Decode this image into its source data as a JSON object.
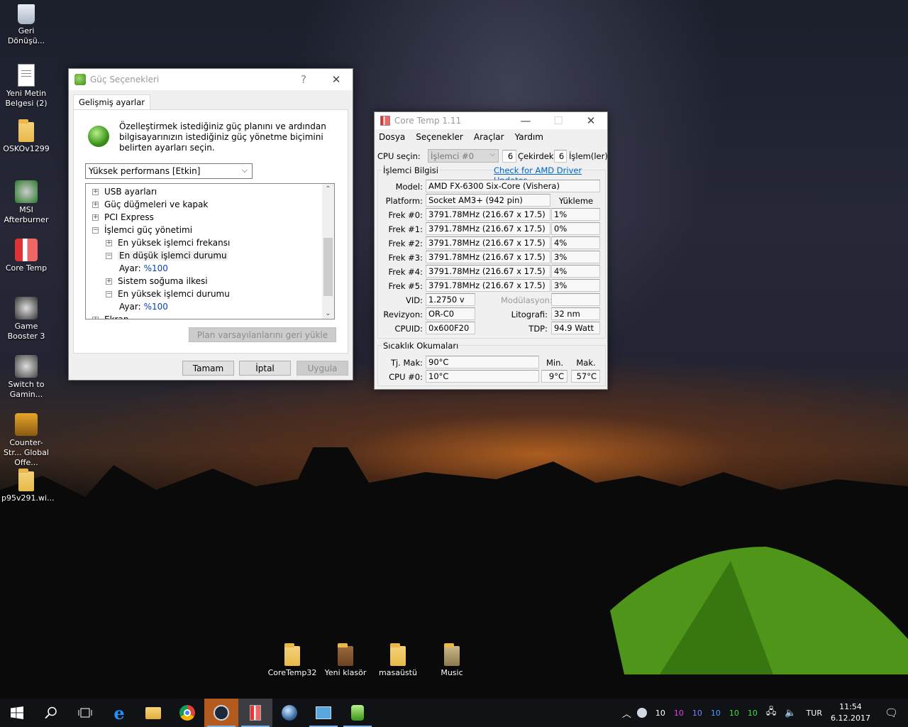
{
  "desktop": {
    "icons": [
      {
        "label": "Geri Dönüşü...",
        "icon": "recycle-bin-icon"
      },
      {
        "label": "Yeni Metin Belgesi (2)",
        "icon": "text-file-icon"
      },
      {
        "label": "OSKOv1299",
        "icon": "folder-icon"
      },
      {
        "label": "MSI Afterburner",
        "icon": "msi-afterburner-icon"
      },
      {
        "label": "Core Temp",
        "icon": "core-temp-icon"
      },
      {
        "label": "Game Booster 3",
        "icon": "game-booster-icon"
      },
      {
        "label": "Switch to Gamin...",
        "icon": "switch-gaming-icon"
      },
      {
        "label": "Counter-Str... Global Offe...",
        "icon": "csgo-icon"
      },
      {
        "label": "p95v291.wi...",
        "icon": "folder-icon"
      }
    ],
    "bottom_icons": [
      {
        "label": "CoreTemp32"
      },
      {
        "label": "Yeni klasör"
      },
      {
        "label": "masaüstü"
      },
      {
        "label": "Music"
      }
    ]
  },
  "power_dialog": {
    "title": "Güç Seçenekleri",
    "help": "?",
    "close": "✕",
    "tab": "Gelişmiş ayarlar",
    "description": "Özelleştirmek istediğiniz güç planını ve ardından bilgisayarınızın istediğiniz güç yönetme biçimini belirten ayarları seçin.",
    "plan_select": "Yüksek performans [Etkin]",
    "tree": [
      {
        "indent": 0,
        "sign": "+",
        "label": "USB ayarları"
      },
      {
        "indent": 0,
        "sign": "+",
        "label": "Güç düğmeleri ve kapak"
      },
      {
        "indent": 0,
        "sign": "+",
        "label": "PCI Express"
      },
      {
        "indent": 0,
        "sign": "−",
        "label": "İşlemci güç yönetimi"
      },
      {
        "indent": 1,
        "sign": "+",
        "label": "En yüksek işlemci frekansı"
      },
      {
        "indent": 1,
        "sign": "−",
        "label": "En düşük işlemci durumu"
      },
      {
        "indent": 2,
        "sign": "",
        "label": "Ayar:",
        "value": "%100"
      },
      {
        "indent": 1,
        "sign": "+",
        "label": "Sistem soğuma ilkesi"
      },
      {
        "indent": 1,
        "sign": "−",
        "label": "En yüksek işlemci durumu"
      },
      {
        "indent": 2,
        "sign": "",
        "label": "Ayar:",
        "value": "%100"
      },
      {
        "indent": 0,
        "sign": "+",
        "label": "Ekran"
      }
    ],
    "restore_button": "Plan varsayılanlarını geri yükle",
    "ok_button": "Tamam",
    "cancel_button": "İptal",
    "apply_button": "Uygula"
  },
  "coretemp": {
    "title": "Core Temp 1.11",
    "menu": [
      "Dosya",
      "Seçenekler",
      "Araçlar",
      "Yardım"
    ],
    "cpu_select_label": "CPU seçin:",
    "cpu_select_value": "İşlemci #0",
    "cores_count": "6",
    "cores_label": "Çekirdek(ler)",
    "threads_count": "6",
    "threads_label": "İşlem(ler)",
    "group_cpu": "İşlemci Bilgisi",
    "amd_link": "Check for AMD Driver Updates",
    "model_label": "Model:",
    "model_value": "AMD FX-6300 Six-Core (Vishera)",
    "platform_label": "Platform:",
    "platform_value": "Socket AM3+ (942 pin)",
    "load_header": "Yükleme",
    "freqs": [
      {
        "label": "Frek #0:",
        "value": "3791.78MHz (216.67 x 17.5)",
        "load": "1%"
      },
      {
        "label": "Frek #1:",
        "value": "3791.78MHz (216.67 x 17.5)",
        "load": "0%"
      },
      {
        "label": "Frek #2:",
        "value": "3791.78MHz (216.67 x 17.5)",
        "load": "4%"
      },
      {
        "label": "Frek #3:",
        "value": "3791.78MHz (216.67 x 17.5)",
        "load": "3%"
      },
      {
        "label": "Frek #4:",
        "value": "3791.78MHz (216.67 x 17.5)",
        "load": "4%"
      },
      {
        "label": "Frek #5:",
        "value": "3791.78MHz (216.67 x 17.5)",
        "load": "3%"
      }
    ],
    "vid_label": "VID:",
    "vid_value": "1.2750 v",
    "modulation_label": "Modülasyon::",
    "revision_label": "Revizyon:",
    "revision_value": "OR-C0",
    "litho_label": "Litografi:",
    "litho_value": "32 nm",
    "cpuid_label": "CPUID:",
    "cpuid_value": "0x600F20",
    "tdp_label": "TDP:",
    "tdp_value": "94.9 Watt",
    "group_temp": "Sıcaklık Okumaları",
    "tjmax_label": "Tj. Mak:",
    "tjmax_value": "90°C",
    "min_header": "Min.",
    "max_header": "Mak.",
    "cpu0_label": "CPU #0:",
    "cpu0_value": "10°C",
    "cpu0_min": "9°C",
    "cpu0_max": "57°C"
  },
  "taskbar": {
    "tray_numbers": [
      {
        "value": "10",
        "color": "#ffffff"
      },
      {
        "value": "10",
        "color": "#e040e0"
      },
      {
        "value": "10",
        "color": "#8080ff"
      },
      {
        "value": "10",
        "color": "#40a0ff"
      },
      {
        "value": "10",
        "color": "#40e040"
      },
      {
        "value": "10",
        "color": "#40e040"
      }
    ],
    "language": "TUR",
    "time": "11:54",
    "date": "6.12.2017"
  }
}
